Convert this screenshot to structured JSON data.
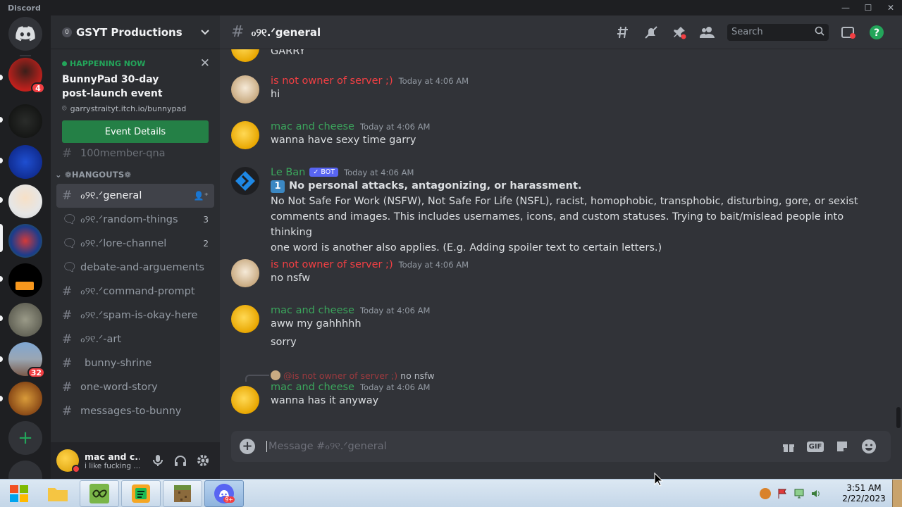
{
  "window": {
    "app_title": "Discord"
  },
  "rail": {
    "home_label": "Direct Messages",
    "servers": [
      {
        "name": "server-1",
        "badge": "4"
      },
      {
        "name": "server-2",
        "badge": ""
      },
      {
        "name": "server-3",
        "badge": ""
      },
      {
        "name": "server-4",
        "badge": ""
      },
      {
        "name": "server-5",
        "badge": ""
      },
      {
        "name": "server-6",
        "badge": ""
      },
      {
        "name": "server-7",
        "badge": ""
      },
      {
        "name": "server-8",
        "badge": "32"
      },
      {
        "name": "server-9",
        "badge": ""
      }
    ],
    "add_server_glyph": "+"
  },
  "server": {
    "boost_count": "0",
    "name": "GSYT Productions"
  },
  "event": {
    "status": "HAPPENING NOW",
    "title": "BunnyPad 30-day post-launch event",
    "location": "garrystraityt.itch.io/bunnypad",
    "button": "Event Details"
  },
  "channels": {
    "partial_top": "100member-qna",
    "category": "﻿HANGOUTS",
    "items": [
      {
        "name": "general",
        "type": "text",
        "count": "",
        "active": true
      },
      {
        "name": "random-things",
        "type": "forum",
        "count": "3"
      },
      {
        "name": "lore-channel",
        "type": "forum",
        "count": "2"
      },
      {
        "name": "debate-and-arguements",
        "type": "forum",
        "count": ""
      },
      {
        "name": "command-prompt",
        "type": "text",
        "count": ""
      },
      {
        "name": "spam-is-okay-here",
        "type": "text",
        "count": ""
      },
      {
        "name": "-art",
        "type": "text",
        "count": ""
      },
      {
        "name": "bunny-shrine",
        "type": "text",
        "count": ""
      },
      {
        "name": "one-word-story",
        "type": "text",
        "count": ""
      },
      {
        "name": "messages-to-bunny",
        "type": "text",
        "count": ""
      }
    ]
  },
  "user": {
    "name": "mac and c...",
    "status": "i like fucking ..."
  },
  "header": {
    "channel_name": "general",
    "search_placeholder": "Search"
  },
  "messages": [
    {
      "author": "",
      "time": "",
      "lines": [
        "GARRY"
      ],
      "color": "#dbdee1"
    },
    {
      "author": "is not owner of server ;)",
      "time": "Today at 4:06 AM",
      "lines": [
        "hi"
      ],
      "color": "#f23f43"
    },
    {
      "author": "mac and cheese",
      "time": "Today at 4:06 AM",
      "lines": [
        "wanna have sexy time garry"
      ],
      "color": "#3ba55c"
    },
    {
      "author": "Le Ban",
      "bot": "✓ BOT",
      "time": "Today at 4:06 AM",
      "lines": [
        "1 No personal attacks, antagonizing, or harassment.",
        "No Not Safe For Work (NSFW), Not Safe For Life (NSFL), racist, homophobic, transphobic, disturbing, gore, or sexist",
        "comments and images. This includes usernames, icons, and custom statuses. Trying to bait/mislead people into thinking",
        "one word is another also applies. (E.g. Adding spoiler text to certain letters.)"
      ],
      "color": "#3ba55c"
    },
    {
      "author": "is not owner of server ;)",
      "time": "Today at 4:06 AM",
      "lines": [
        "no nsfw"
      ],
      "color": "#f23f43"
    },
    {
      "author": "mac and cheese",
      "time": "Today at 4:06 AM",
      "lines": [
        "aww my gahhhhh",
        "sorry"
      ],
      "color": "#3ba55c"
    },
    {
      "reply_author": "@is not owner of server ;)",
      "reply_text": "no nsfw",
      "author": "mac and cheese",
      "time": "Today at 4:06 AM",
      "lines": [
        "wanna has it anyway"
      ],
      "color": "#3ba55c"
    }
  ],
  "composer": {
    "placeholder": "Message #general"
  },
  "taskbar": {
    "time": "3:51 AM",
    "date": "2/22/2023",
    "discord_badge": "9+"
  }
}
